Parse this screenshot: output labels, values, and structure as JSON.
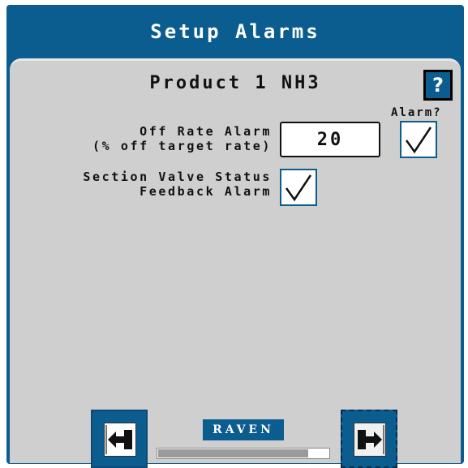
{
  "header": {
    "title": "Setup Alarms"
  },
  "panel": {
    "product_title": "Product 1 NH3",
    "help_label": "?",
    "alarm_column_header": "Alarm?",
    "off_rate": {
      "label_line1": "Off Rate Alarm",
      "label_line2": "(% off target rate)",
      "value": "20",
      "alarm_checked": true
    },
    "section_valve": {
      "label_line1": "Section Valve Status",
      "label_line2": "Feedback Alarm",
      "checked": true
    }
  },
  "footer": {
    "logo_text": "RAVEN",
    "progress_fraction": 0.88,
    "back_icon": "back-arrow-icon",
    "next_icon": "next-arrow-icon"
  },
  "colors": {
    "brand_blue": "#0b5c8f",
    "panel_gray": "#cfcfcf"
  }
}
